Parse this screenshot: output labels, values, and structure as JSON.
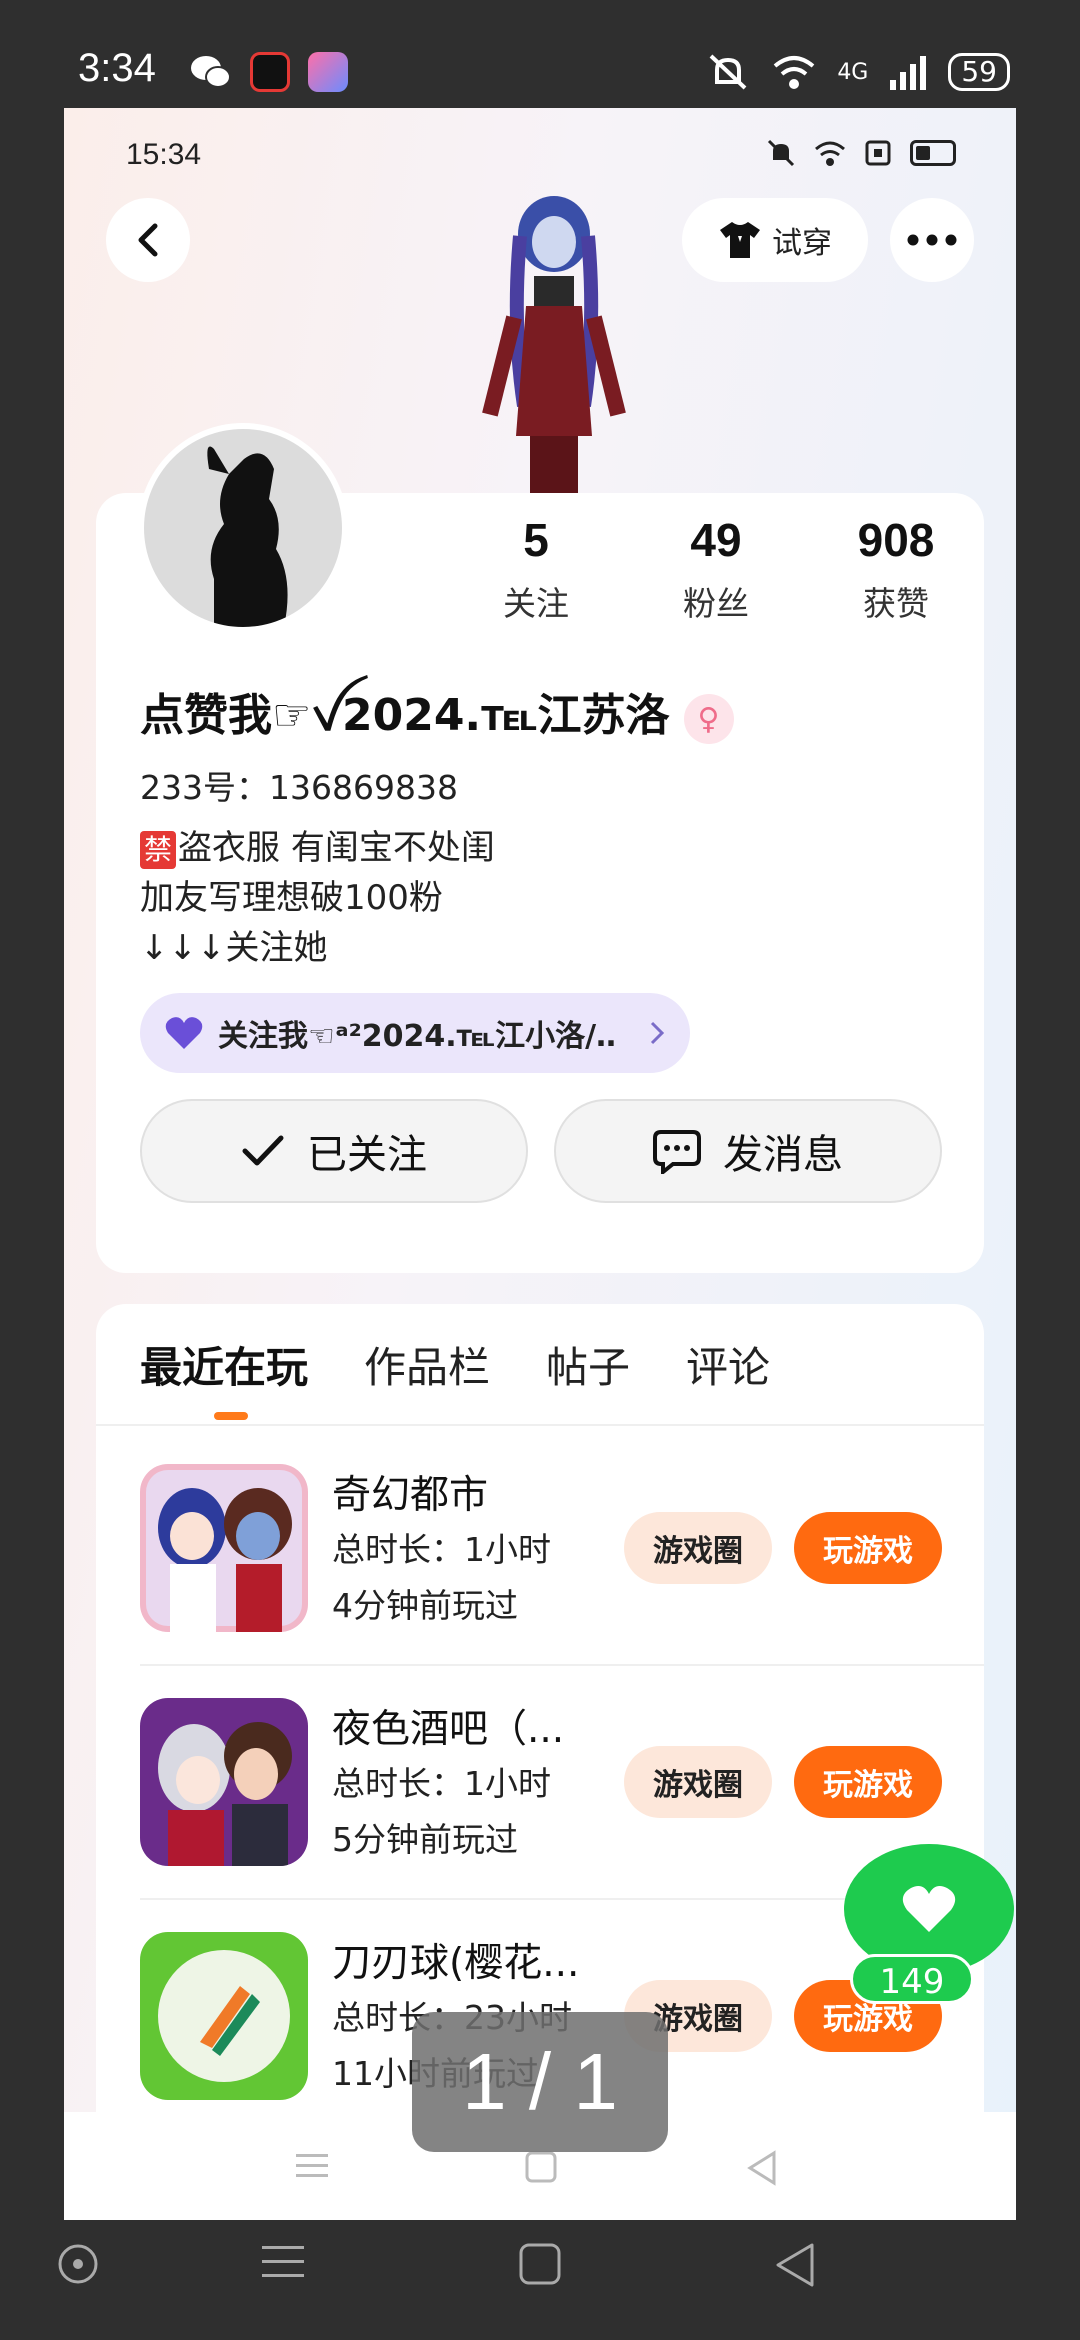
{
  "outer_status": {
    "time": "3:34",
    "battery": "59",
    "network": "4G"
  },
  "inner_status": {
    "time": "15:34"
  },
  "header": {
    "try_on_label": "试穿"
  },
  "profile": {
    "stats": [
      {
        "num": "5",
        "label": "关注"
      },
      {
        "num": "49",
        "label": "粉丝"
      },
      {
        "num": "908",
        "label": "获赞"
      }
    ],
    "name": "点赞我☞ꪜ2024.℡江苏洛",
    "gender_symbol": "♀",
    "uid": "233号：136869838",
    "bio_ban": "禁",
    "bio_line1": "盗衣服 有闺宝不处闺",
    "bio_line2": "加友写理想破100粉",
    "bio_line3": "↓↓↓关注她",
    "group_text": "关注我☜ᵃ²2024.℡江小洛/‥",
    "followed_label": "已关注",
    "message_label": "发消息"
  },
  "tabs": [
    "最近在玩",
    "作品栏",
    "帖子",
    "评论"
  ],
  "games": [
    {
      "name": "奇幻都市",
      "duration": "总时长：1小时",
      "last_played": "4分钟前玩过",
      "circle": "游戏圈",
      "play": "玩游戏"
    },
    {
      "name": "夜色酒吧（...",
      "duration": "总时长：1小时",
      "last_played": "5分钟前玩过",
      "circle": "游戏圈",
      "play": "玩游戏"
    },
    {
      "name": "刀刃球(樱花...",
      "duration": "总时长：23小时",
      "last_played": "11小时前玩过",
      "circle": "游戏圈",
      "play": "玩游戏"
    }
  ],
  "like_count": "149",
  "page_indicator": "1 / 1"
}
